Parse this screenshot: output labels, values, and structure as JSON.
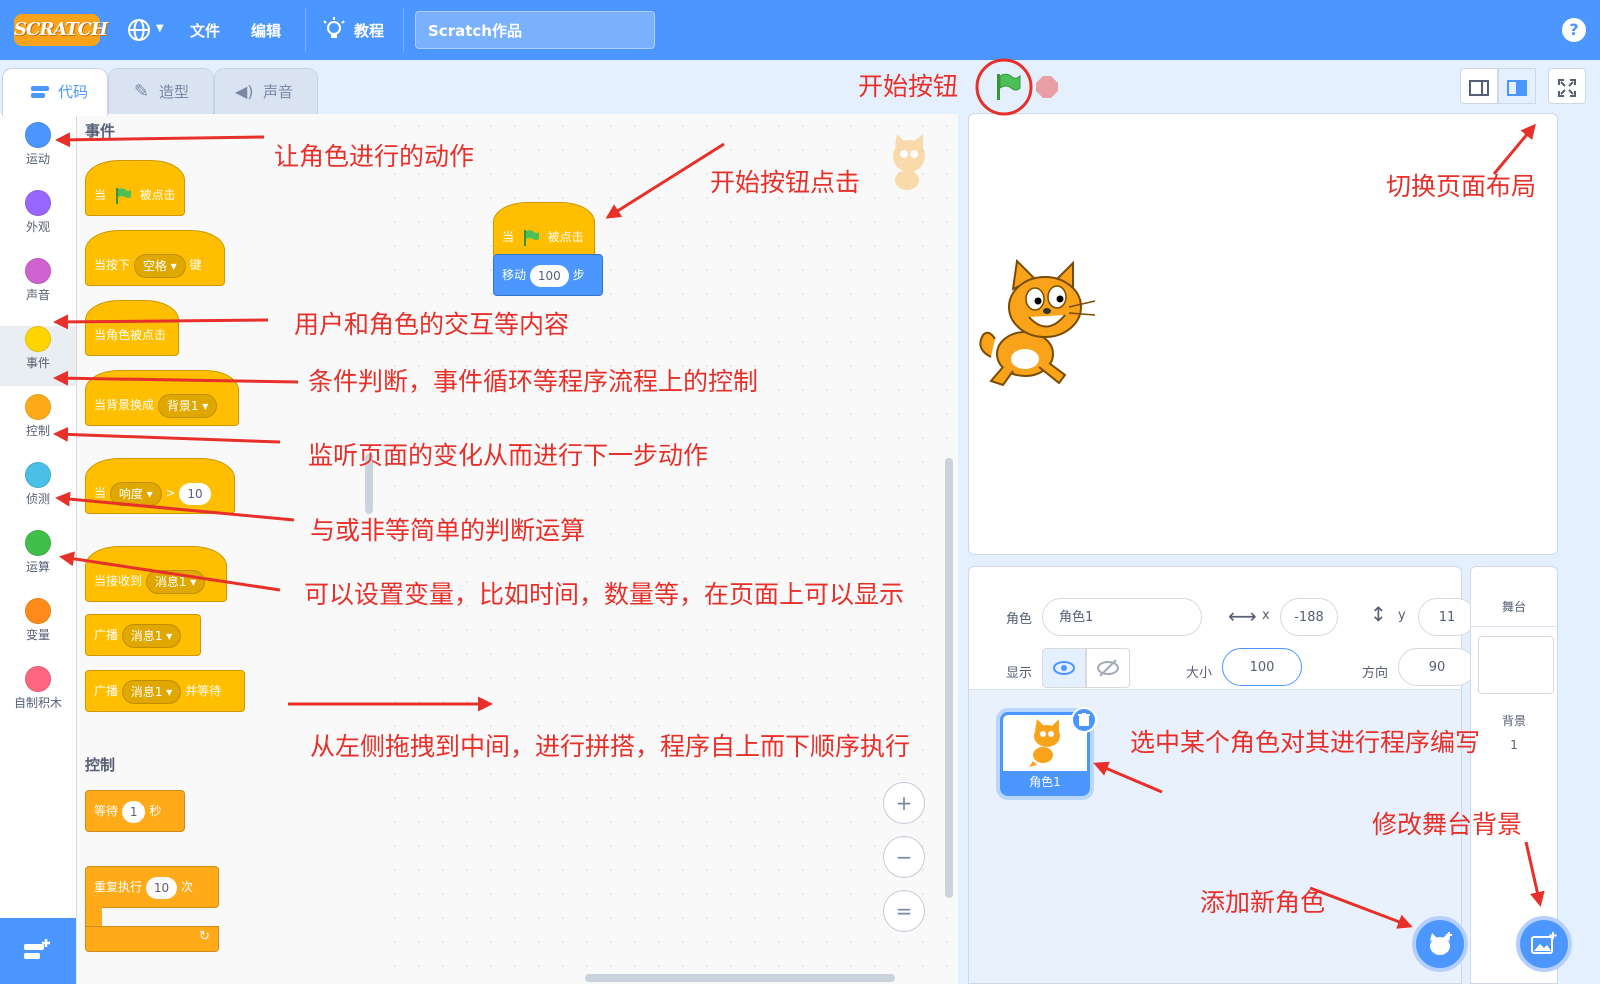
{
  "menubar": {
    "logo": "SCRATCH",
    "file": "文件",
    "edit": "编辑",
    "tutorial": "教程",
    "project_title": "Scratch作品",
    "help": "?"
  },
  "tabs": {
    "code": "代码",
    "costume": "造型",
    "sound": "声音"
  },
  "categories": [
    {
      "label": "运动",
      "color": "#4c97ff"
    },
    {
      "label": "外观",
      "color": "#9966ff"
    },
    {
      "label": "声音",
      "color": "#cf63cf"
    },
    {
      "label": "事件",
      "color": "#ffd500"
    },
    {
      "label": "控制",
      "color": "#ffab19"
    },
    {
      "label": "侦测",
      "color": "#4cbfe6"
    },
    {
      "label": "运算",
      "color": "#40bf4a"
    },
    {
      "label": "变量",
      "color": "#ff8c1a"
    },
    {
      "label": "自制积木",
      "color": "#ff6680"
    }
  ],
  "palette": {
    "events_title": "事件",
    "when_flag_a": "当",
    "when_flag_b": "被点击",
    "when_key_a": "当按下",
    "when_key_opt": "空格",
    "when_key_b": "键",
    "when_sprite_clicked": "当角色被点击",
    "when_backdrop_a": "当背景换成",
    "when_backdrop_opt": "背景1",
    "when_gt_a": "当",
    "when_gt_opt": "响度",
    "when_gt_op": ">",
    "when_gt_val": "10",
    "when_receive_a": "当接收到",
    "when_receive_opt": "消息1",
    "broadcast_a": "广播",
    "broadcast_opt": "消息1",
    "broadcast_wait_a": "广播",
    "broadcast_wait_opt": "消息1",
    "broadcast_wait_b": "并等待",
    "control_title": "控制",
    "wait_a": "等待",
    "wait_val": "1",
    "wait_b": "秒",
    "repeat_a": "重复执行",
    "repeat_val": "10",
    "repeat_b": "次"
  },
  "script": {
    "hat_a": "当",
    "hat_b": "被点击",
    "move_a": "移动",
    "move_val": "100",
    "move_b": "步"
  },
  "zoom": {
    "in": "+",
    "out": "−",
    "reset": "="
  },
  "sprite_info": {
    "sprite_label": "角色",
    "sprite_name": "角色1",
    "x_label": "x",
    "x_value": "-188",
    "y_label": "y",
    "y_value": "11",
    "show_label": "显示",
    "size_label": "大小",
    "size_value": "100",
    "direction_label": "方向",
    "direction_value": "90"
  },
  "sprite_list": [
    {
      "name": "角色1"
    }
  ],
  "stage_panel": {
    "title": "舞台",
    "backdrops_label": "背景",
    "backdrops_count": "1"
  },
  "annotations": {
    "start_button": "开始按钮",
    "motion": "让角色进行的动作",
    "flag_click": "开始按钮点击",
    "switch_layout": "切换页面布局",
    "events": "用户和角色的交互等内容",
    "control": "条件判断，事件循环等程序流程上的控制",
    "sensing": "监听页面的变化从而进行下一步动作",
    "operators": "与或非等简单的判断运算",
    "variables": "可以设置变量，比如时间，数量等，在页面上可以显示",
    "drag": "从左侧拖拽到中间，进行拼搭，程序自上而下顺序执行",
    "select_sprite": "选中某个角色对其进行程序编写",
    "change_backdrop": "修改舞台背景",
    "add_sprite": "添加新角色"
  },
  "colors": {
    "menubar": "#4c97ff",
    "events_block": "#ffbf00",
    "control_block": "#ffab19",
    "motion_block": "#4c97ff",
    "annotation": "#e8302a",
    "flag_green": "#4cbf56",
    "stop_red": "#ec5959"
  },
  "icons": [
    "globe-icon",
    "lightbulb-icon",
    "green-flag-icon",
    "stop-icon",
    "eye-icon",
    "eye-hidden-icon",
    "trash-icon",
    "add-sprite-icon",
    "add-backdrop-icon",
    "extension-icon",
    "fullscreen-icon"
  ]
}
